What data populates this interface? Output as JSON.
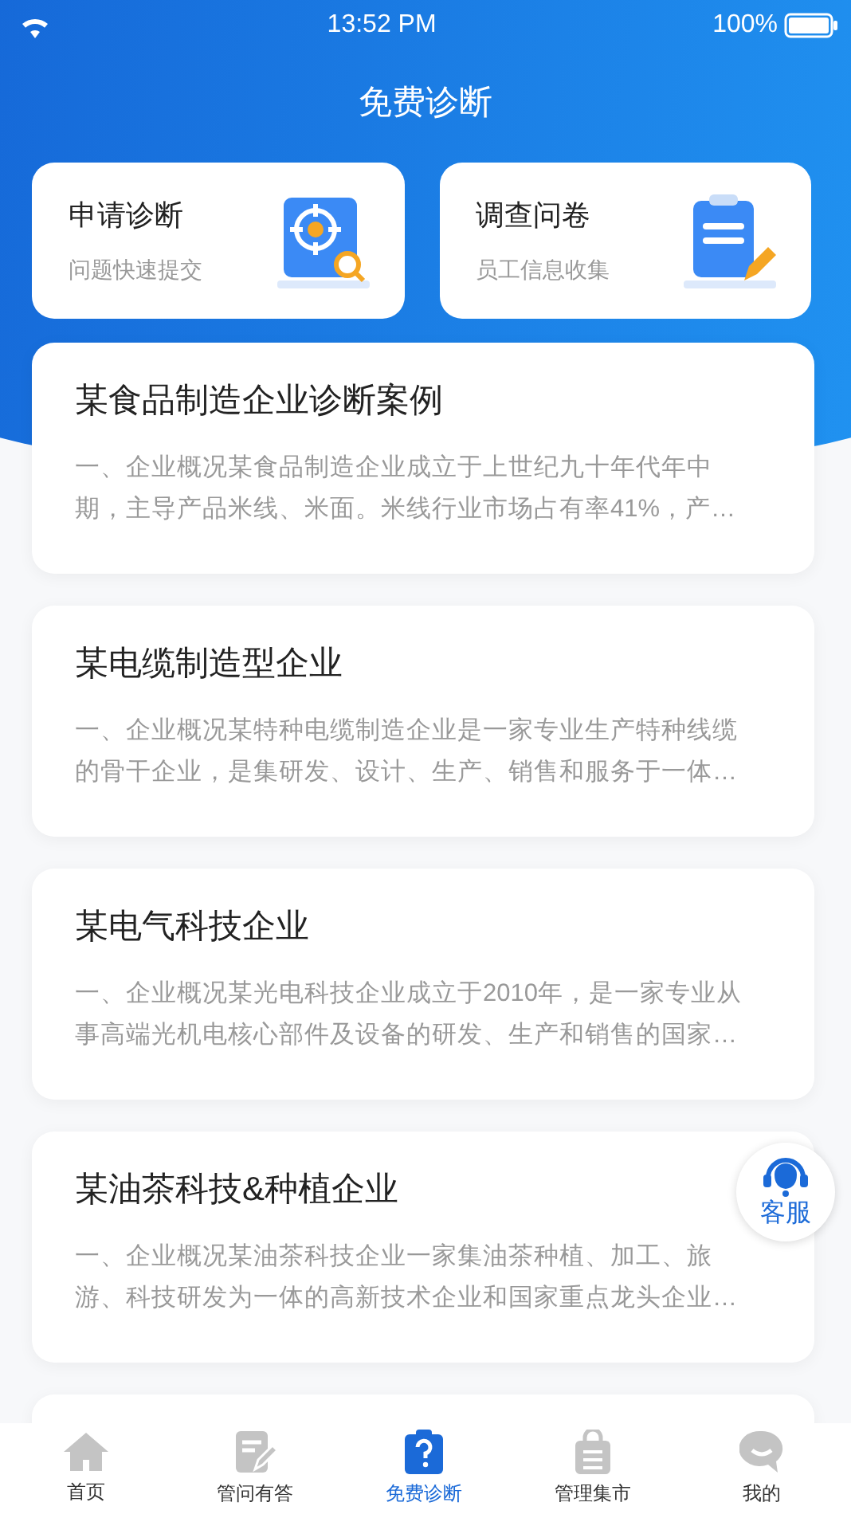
{
  "status_bar": {
    "time": "13:52 PM",
    "battery": "100%"
  },
  "header": {
    "title": "免费诊断"
  },
  "quick_actions": [
    {
      "kind": "target",
      "title": "申请诊断",
      "subtitle": "问题快速提交"
    },
    {
      "kind": "survey",
      "title": "调查问卷",
      "subtitle": "员工信息收集"
    }
  ],
  "cases": [
    {
      "title": "某食品制造企业诊断案例",
      "summary": "一、企业概况某食品制造企业成立于上世纪九十年代年中期，主导产品米线、米面。米线行业市场占有率41%，产…"
    },
    {
      "title": "某电缆制造型企业",
      "summary": "一、企业概况某特种电缆制造企业是一家专业生产特种线缆的骨干企业，是集研发、设计、生产、销售和服务于一体…"
    },
    {
      "title": "某电气科技企业",
      "summary": "一、企业概况某光电科技企业成立于2010年，是一家专业从事高端光机电核心部件及设备的研发、生产和销售的国家…"
    },
    {
      "title": "某油茶科技&种植企业",
      "summary": "一、企业概况某油茶科技企业一家集油茶种植、加工、旅游、科技研发为一体的高新技术企业和国家重点龙头企业…"
    }
  ],
  "service_button": {
    "label": "客服"
  },
  "tab_bar": [
    {
      "kind": "home",
      "label": "首页",
      "selected": false
    },
    {
      "kind": "qa",
      "label": "管问有答",
      "selected": false
    },
    {
      "kind": "diagnosis",
      "label": "免费诊断",
      "selected": true
    },
    {
      "kind": "market",
      "label": "管理集市",
      "selected": false
    },
    {
      "kind": "me",
      "label": "我的",
      "selected": false
    }
  ]
}
